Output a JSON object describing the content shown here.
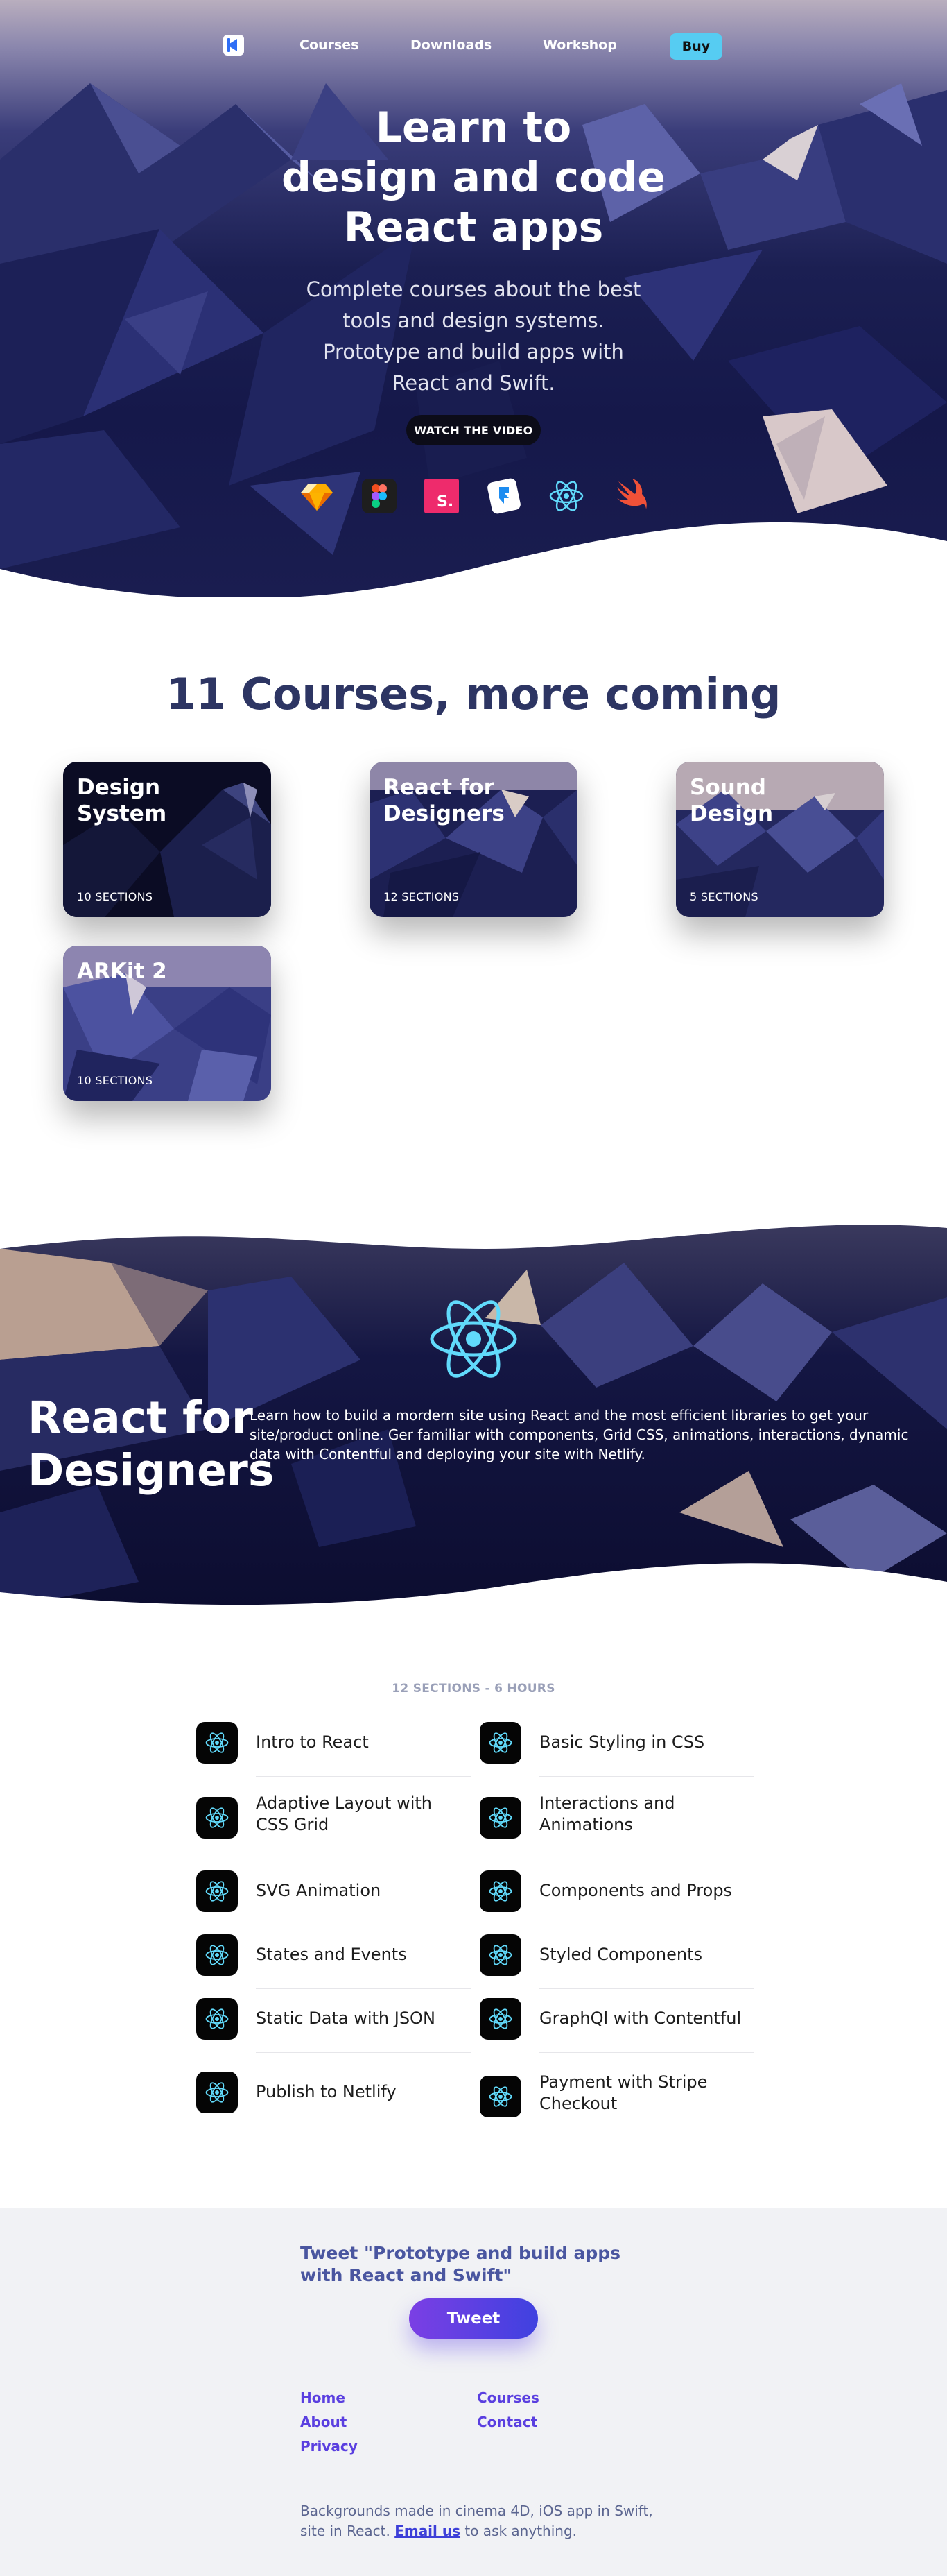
{
  "nav": {
    "courses": "Courses",
    "downloads": "Downloads",
    "workshop": "Workshop",
    "buy": "Buy"
  },
  "hero": {
    "title_line1": "Learn to",
    "title_line2": "design and code",
    "title_line3": "React apps",
    "subtitle": "Complete courses about the best tools and design systems. Prototype and build apps with React and Swift.",
    "watch": "WATCH THE VIDEO",
    "tools": [
      "sketch-icon",
      "figma-icon",
      "studio-icon",
      "framer-icon",
      "react-icon",
      "swift-icon"
    ]
  },
  "courses": {
    "heading": "11 Courses, more coming",
    "cards": [
      {
        "title": "Design System",
        "sections": "10 SECTIONS"
      },
      {
        "title": "React for Designers",
        "sections": "12 SECTIONS"
      },
      {
        "title": "Sound Design",
        "sections": "5 SECTIONS"
      },
      {
        "title": "ARKit 2",
        "sections": "10 SECTIONS"
      }
    ]
  },
  "banner": {
    "title": "React for Designers",
    "text": "Learn how to build a mordern site using React and the most efficient libraries to get your site/product online. Ger familiar with components, Grid CSS, animations, interactions, dynamic data with Contentful and deploying your site with Netlify."
  },
  "sections": {
    "heading": "12 SECTIONS - 6 HOURS",
    "items": [
      "Intro to React",
      "Basic Styling in CSS",
      "Adaptive Layout with CSS Grid",
      "Interactions and Animations",
      "SVG Animation",
      "Components and Props",
      "States and Events",
      "Styled Components",
      "Static Data with JSON",
      "GraphQl with Contentful",
      "Publish to Netlify",
      "Payment with Stripe Checkout"
    ]
  },
  "footer": {
    "tweet_text": "Tweet \"Prototype and build apps with React and Swift\"",
    "tweet_button": "Tweet",
    "links": {
      "home": "Home",
      "about": "About",
      "privacy": "Privacy",
      "courses": "Courses",
      "contact": "Contact"
    },
    "credits_before": "Backgrounds made in cinema 4D, iOS app in Swift, site in React.",
    "credits_email": "Email us",
    "credits_after": "to ask anything."
  },
  "colors": {
    "accent_buy": "#56ccf2",
    "heading_navy": "#2d3563",
    "react_cyan": "#61dafb",
    "tweet_gradient_start": "#7b3fe4",
    "tweet_gradient_end": "#3f41e0"
  }
}
